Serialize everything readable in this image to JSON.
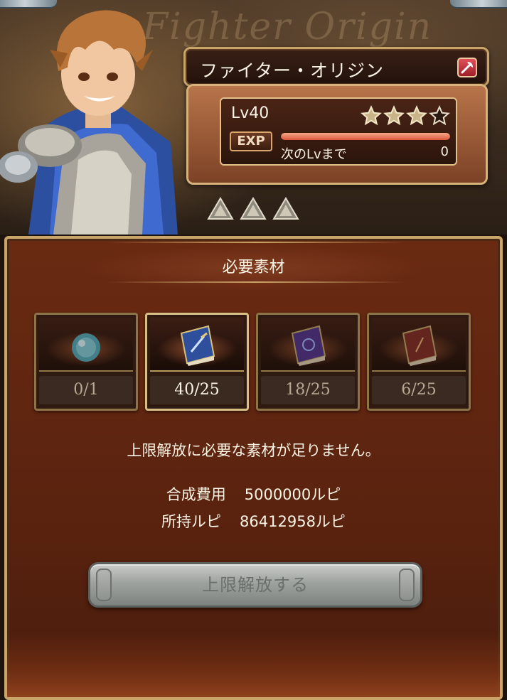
{
  "hero": {
    "watermark": "Fighter Origin",
    "class_name": "ファイター・オリジン",
    "class_icon": "axe-icon",
    "level_label": "Lv40",
    "stars_total": 4,
    "stars_filled": 3,
    "exp_tag": "EXP",
    "exp_progress": 1.0,
    "next_label": "次のLvまで",
    "next_value": "0",
    "uncap_markers": 3
  },
  "panel": {
    "title": "必要素材",
    "materials": [
      {
        "name": "orb",
        "icon": "crystal-orb-icon",
        "count": "0/1",
        "ok": false
      },
      {
        "name": "book-blue",
        "icon": "blue-sword-book-icon",
        "count": "40/25",
        "ok": true
      },
      {
        "name": "book-purple",
        "icon": "purple-book-icon",
        "count": "18/25",
        "ok": false
      },
      {
        "name": "book-red",
        "icon": "red-book-icon",
        "count": "6/25",
        "ok": false
      }
    ],
    "warning": "上限解放に必要な素材が足りません。",
    "cost_label": "合成費用",
    "cost_value": "5000000ルピ",
    "owned_label": "所持ルピ",
    "owned_value": "86412958ルピ",
    "button_label": "上限解放する"
  },
  "colors": {
    "panel": "#5a230f",
    "gold_border": "#c9a56a",
    "exp_fill": "#d9583a",
    "button_disabled": "#9ea29f"
  }
}
